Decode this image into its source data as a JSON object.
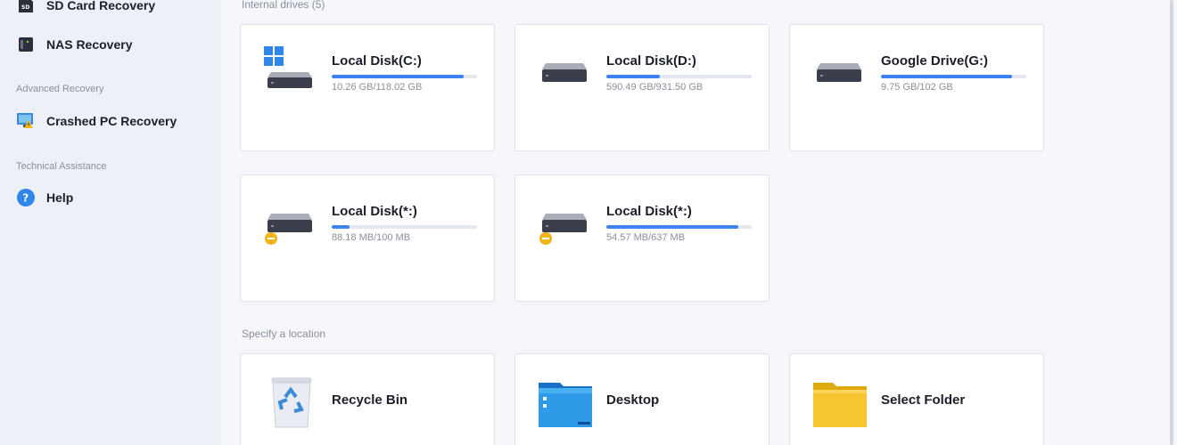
{
  "sidebar": {
    "items": [
      {
        "label": "SD Card Recovery",
        "icon": "sd-card-icon"
      },
      {
        "label": "NAS Recovery",
        "icon": "nas-icon"
      },
      {
        "label": "Crashed PC Recovery",
        "icon": "crashed-pc-icon"
      },
      {
        "label": "Help",
        "icon": "help-icon"
      }
    ],
    "sections": {
      "advanced": "Advanced Recovery",
      "technical": "Technical Assistance"
    }
  },
  "main": {
    "internal_label": "Internal drives (5)",
    "drives": [
      {
        "name": "Local Disk(C:)",
        "size": "10.26 GB/118.02 GB",
        "used_fraction": 0.91,
        "icon": "windows-drive-icon"
      },
      {
        "name": "Local Disk(D:)",
        "size": "590.49 GB/931.50 GB",
        "used_fraction": 0.37,
        "icon": "hard-drive-icon"
      },
      {
        "name": "Google Drive(G:)",
        "size": "9.75 GB/102 GB",
        "used_fraction": 0.9,
        "icon": "hard-drive-icon"
      },
      {
        "name": "Local Disk(*:)",
        "size": "88.18 MB/100 MB",
        "used_fraction": 0.12,
        "icon": "hard-drive-warning-icon"
      },
      {
        "name": "Local Disk(*:)",
        "size": "54.57 MB/637 MB",
        "used_fraction": 0.91,
        "icon": "hard-drive-warning-icon"
      }
    ],
    "location_label": "Specify a location",
    "locations": [
      {
        "name": "Recycle Bin",
        "icon": "recycle-bin-icon"
      },
      {
        "name": "Desktop",
        "icon": "desktop-icon"
      },
      {
        "name": "Select Folder",
        "icon": "folder-icon"
      }
    ]
  },
  "colors": {
    "accent": "#3c82f0",
    "sidebar_bg": "#eef0f7",
    "main_bg": "#f6f7fb"
  }
}
